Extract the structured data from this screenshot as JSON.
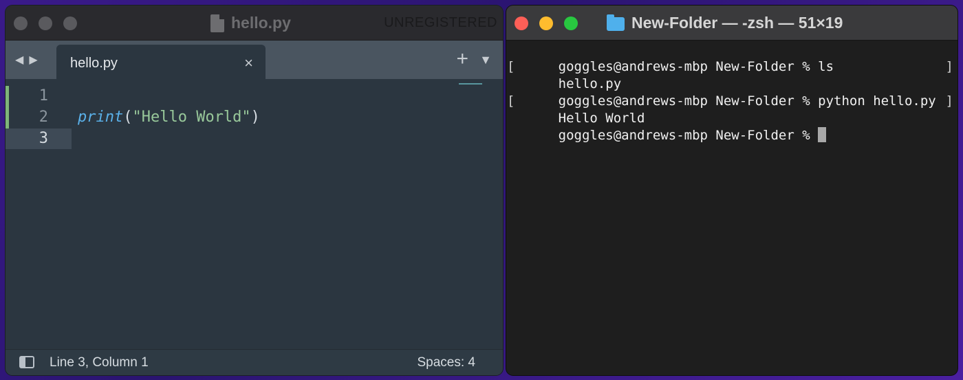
{
  "sublime": {
    "title": "hello.py",
    "unregistered": "UNREGISTERED",
    "tab_label": "hello.py",
    "tab_close": "×",
    "tab_add": "+",
    "tab_menu": "▼",
    "nav_back": "◀",
    "nav_forward": "▶",
    "lines": [
      {
        "num": "1",
        "code_kw": "",
        "code_paren_open": "",
        "code_str": "",
        "code_paren_close": ""
      },
      {
        "num": "2",
        "code_kw": "print",
        "code_paren_open": "(",
        "code_str": "\"Hello World\"",
        "code_paren_close": ")"
      },
      {
        "num": "3",
        "code_kw": "",
        "code_paren_open": "",
        "code_str": "",
        "code_paren_close": ""
      }
    ],
    "status": {
      "position": "Line 3, Column 1",
      "spaces": "Spaces: 4"
    }
  },
  "terminal": {
    "title": "New-Folder — -zsh — 51×19",
    "lines": [
      "goggles@andrews-mbp New-Folder % ls",
      "hello.py",
      "goggles@andrews-mbp New-Folder % python hello.py",
      "Hello World",
      "goggles@andrews-mbp New-Folder % "
    ]
  },
  "colors": {
    "close": "#fe5f57",
    "minimize": "#febc2e",
    "zoom": "#28c840",
    "keyword": "#5ab0e8",
    "string": "#98c89a"
  }
}
